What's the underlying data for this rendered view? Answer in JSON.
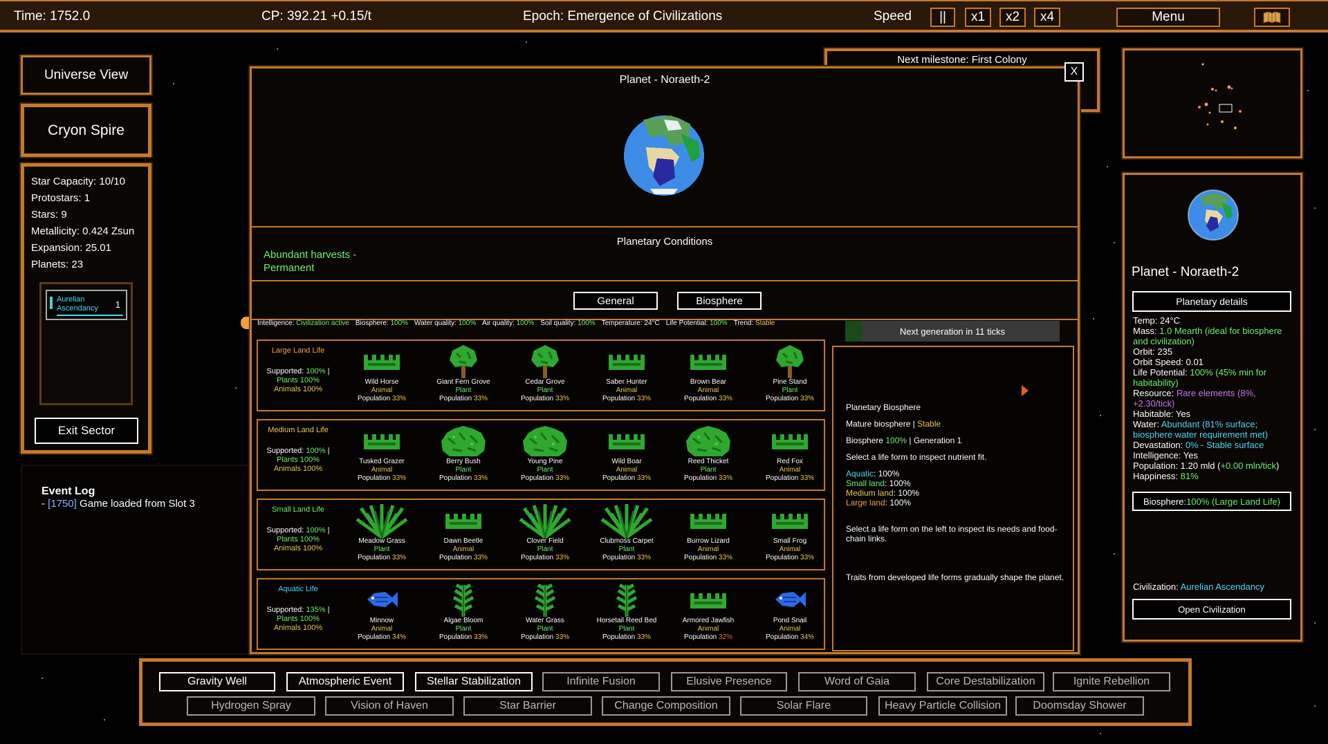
{
  "topbar": {
    "time": "Time: 1752.0",
    "cp": "CP: 392.21 +0.15/t",
    "epoch": "Epoch: Emergence of Civilizations",
    "speed_label": "Speed",
    "pause": "||",
    "x1": "x1",
    "x2": "x2",
    "x4": "x4",
    "menu": "Menu"
  },
  "left": {
    "universe_view": "Universe View",
    "sector_name": "Cryon Spire",
    "stats": [
      "Star Capacity: 10/10",
      "Protostars: 1",
      "Stars: 9",
      "Metallicity: 0.424 Zsun",
      "Expansion: 25.01",
      "Planets: 23"
    ],
    "civ_name_1": "Aurelian",
    "civ_name_2": "Ascendancy",
    "civ_count": "1",
    "exit_sector": "Exit Sector",
    "event_log_title": "Event Log",
    "event_prefix": "- ",
    "event_time": "[1750]",
    "event_text": " Game loaded from Slot 3"
  },
  "milestone": "Next milestone: First Colony",
  "modal": {
    "close": "X",
    "title": "Planet - Noraeth-2",
    "conditions_title": "Planetary Conditions",
    "condition_1": "Abundant harvests -",
    "condition_2": "Permanent",
    "tab_general": "General",
    "tab_biosphere": "Biosphere",
    "status": [
      {
        "k": "Intelligence: ",
        "v": "Civilization active"
      },
      {
        "k": "Biosphere: ",
        "v": "100%"
      },
      {
        "k": "Water quality: ",
        "v": "100%"
      },
      {
        "k": "Air quality: ",
        "v": "100%"
      },
      {
        "k": "Soil quality: ",
        "v": "100%"
      },
      {
        "k": "Temperature: 24°C",
        "v": ""
      },
      {
        "k": "Life Potential: ",
        "v": "100%"
      },
      {
        "k": "Trend: ",
        "v": "Stable"
      }
    ],
    "next_gen": "Next generation in 11 ticks",
    "rows": [
      {
        "title": "Large Land Life",
        "title_color": "#f0a040",
        "sup_pct": "100%",
        "plants": "Plants 100%",
        "animals": "Animals 100%",
        "items": [
          {
            "name": "Wild Horse",
            "type": "Animal",
            "pop": "33%",
            "icon": "grass"
          },
          {
            "name": "Giant Fern Grove",
            "type": "Plant",
            "pop": "33%",
            "icon": "tree"
          },
          {
            "name": "Cedar Grove",
            "type": "Plant",
            "pop": "33%",
            "icon": "tree"
          },
          {
            "name": "Saber Hunter",
            "type": "Animal",
            "pop": "33%",
            "icon": "grass"
          },
          {
            "name": "Brown Bear",
            "type": "Animal",
            "pop": "33%",
            "icon": "grass"
          },
          {
            "name": "Pine Stand",
            "type": "Plant",
            "pop": "33%",
            "icon": "tree"
          }
        ]
      },
      {
        "title": "Medium Land Life",
        "title_color": "#e8c84a",
        "sup_pct": "100%",
        "plants": "Plants 100%",
        "animals": "Animals 100%",
        "items": [
          {
            "name": "Tusked Grazer",
            "type": "Animal",
            "pop": "33%",
            "icon": "grass"
          },
          {
            "name": "Berry Bush",
            "type": "Plant",
            "pop": "33%",
            "icon": "bush"
          },
          {
            "name": "Young Pine",
            "type": "Plant",
            "pop": "33%",
            "icon": "bush"
          },
          {
            "name": "Wild Boar",
            "type": "Animal",
            "pop": "33%",
            "icon": "grass"
          },
          {
            "name": "Reed Thicket",
            "type": "Plant",
            "pop": "33%",
            "icon": "bush"
          },
          {
            "name": "Red Fox",
            "type": "Animal",
            "pop": "33%",
            "icon": "grass"
          }
        ]
      },
      {
        "title": "Small Land Life",
        "title_color": "#6ef06e",
        "sup_pct": "100%",
        "plants": "Plants 100%",
        "animals": "Animals 100%",
        "items": [
          {
            "name": "Meadow Grass",
            "type": "Plant",
            "pop": "33%",
            "icon": "fern"
          },
          {
            "name": "Dawn Beetle",
            "type": "Animal",
            "pop": "33%",
            "icon": "grass"
          },
          {
            "name": "Clover Field",
            "type": "Plant",
            "pop": "33%",
            "icon": "fern"
          },
          {
            "name": "Clubmoss Carpet",
            "type": "Plant",
            "pop": "33%",
            "icon": "fern"
          },
          {
            "name": "Burrow Lizard",
            "type": "Animal",
            "pop": "33%",
            "icon": "grass"
          },
          {
            "name": "Small Frog",
            "type": "Animal",
            "pop": "33%",
            "icon": "grass"
          }
        ]
      },
      {
        "title": "Aquatic Life",
        "title_color": "#4ad8f0",
        "sup_pct": "135%",
        "plants": "Plants 100%",
        "animals": "Animals 100%",
        "items": [
          {
            "name": "Minnow",
            "type": "Animal",
            "pop": "34%",
            "icon": "fish"
          },
          {
            "name": "Algae Bloom",
            "type": "Plant",
            "pop": "33%",
            "icon": "kelp"
          },
          {
            "name": "Water Grass",
            "type": "Plant",
            "pop": "33%",
            "icon": "kelp"
          },
          {
            "name": "Horsetail Reed Bed",
            "type": "Plant",
            "pop": "33%",
            "icon": "kelp"
          },
          {
            "name": "Armored Jawfish",
            "type": "Animal",
            "pop": "32%",
            "icon": "grass",
            "pop_color": "#f06040"
          },
          {
            "name": "Pond Snail",
            "type": "Animal",
            "pop": "34%",
            "icon": "fish"
          }
        ]
      }
    ],
    "supported_label": "Supported: ",
    "population_label": "Population ",
    "info": {
      "heading": "Planetary Biosphere",
      "mature": "Mature biosphere | ",
      "stable": "Stable",
      "bio_label": "Biosphere ",
      "bio_pct": "100%",
      "generation": " | Generation 1",
      "select_hint": "Select a life form to inspect nutrient fit.",
      "aquatic_k": "Aquatic",
      "aquatic_v": ": 100%",
      "small_k": "Small land",
      "small_v": ": 100%",
      "medium_k": "Medium land",
      "medium_v": ": 100%",
      "large_k": "Large land",
      "large_v": ": 100%",
      "left_hint": "Select a life form on the left to inspect its needs and food-chain links.",
      "traits": "Traits from developed life forms gradually shape the planet."
    }
  },
  "right": {
    "planet_name": "Planet - Noraeth-2",
    "details_button": "Planetary details",
    "temp": "Temp: 24°C",
    "mass_k": "Mass: ",
    "mass_v": "1.0 Mearth (ideal for biosphere and civilization)",
    "orbit": "Orbit: 235",
    "orbit_speed": "Orbit Speed: 0.01",
    "life_k": "Life Potential: ",
    "life_v": "100% (45% min for habitability)",
    "resource_k": "Resource: ",
    "resource_v": "Rare elements (8%, +2.30/tick)",
    "habitable": "Habitable: Yes",
    "water_k": "Water: ",
    "water_v": "Abundant (81% surface; biosphere water requirement met)",
    "devastation_k": "Devastation: ",
    "devastation_v": "0% - Stable surface",
    "intelligence": "Intelligence: Yes",
    "population_k": "Population: 1.20 mld (",
    "population_v": "+0.00 mln/tick",
    "population_end": ")",
    "happiness_k": "Happiness: ",
    "happiness_v": "81%",
    "biosphere_k": "Biosphere: ",
    "biosphere_v": "100% (Large Land Life)",
    "civ_k": "Civilization: ",
    "civ_v": "Aurelian Ascendancy",
    "open_civ": "Open Civilization"
  },
  "powers_row1": [
    {
      "label": "Gravity Well",
      "active": true
    },
    {
      "label": "Atmospheric Event",
      "active": true
    },
    {
      "label": "Stellar Stabilization",
      "active": true
    },
    {
      "label": "Infinite Fusion",
      "active": false
    },
    {
      "label": "Elusive Presence",
      "active": false
    },
    {
      "label": "Word of Gaia",
      "active": false
    },
    {
      "label": "Core Destabilization",
      "active": false
    },
    {
      "label": "Ignite Rebellion",
      "active": false
    }
  ],
  "powers_row2": [
    {
      "label": "Hydrogen Spray",
      "active": false
    },
    {
      "label": "Vision of Haven",
      "active": false
    },
    {
      "label": "Star Barrier",
      "active": false
    },
    {
      "label": "Change Composition",
      "active": false
    },
    {
      "label": "Solar Flare",
      "active": false
    },
    {
      "label": "Heavy Particle Collision",
      "active": false
    },
    {
      "label": "Doomsday Shower",
      "active": false
    }
  ],
  "icons": [
    "pause-icon",
    "map-icon",
    "planet-icon",
    "tree-icon",
    "bush-icon",
    "grass-icon",
    "fern-icon",
    "fish-icon",
    "kelp-icon",
    "cursor-icon"
  ]
}
